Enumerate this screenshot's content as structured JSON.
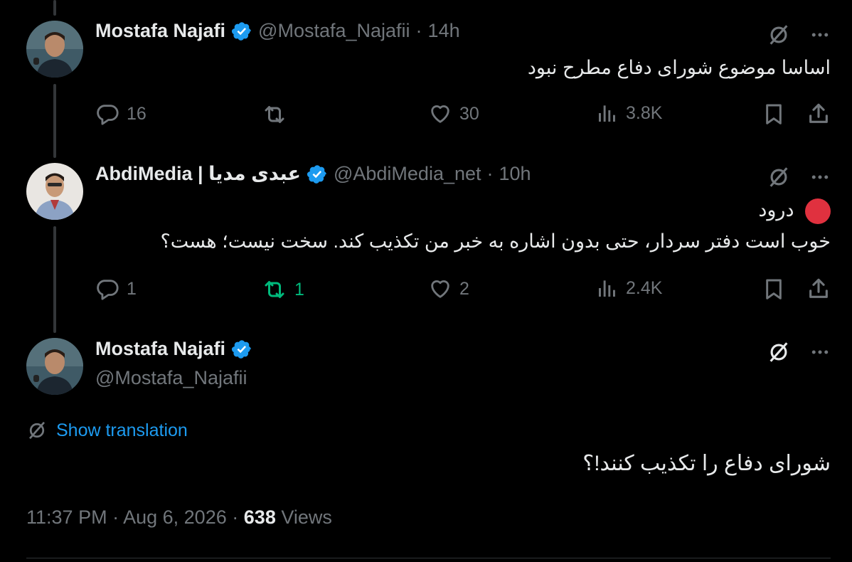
{
  "tweets": [
    {
      "name": "Mostafa Najafi",
      "handle": "@Mostafa_Najafii",
      "time": "14h",
      "text_lines": [
        "اساسا موضوع شورای دفاع مطرح نبود"
      ],
      "replies": "16",
      "reposts": "",
      "likes": "30",
      "views": "3.8K"
    },
    {
      "name": "AbdiMedia | عبدی مدیا",
      "handle": "@AbdiMedia_net",
      "time": "10h",
      "text_lines": [
        "درود",
        "خوب است دفتر سردار، حتی بدون اشاره به خبر من تکذیب کند. سخت نیست؛ هست؟"
      ],
      "replies": "1",
      "reposts": "1",
      "likes": "2",
      "views": "2.4K"
    }
  ],
  "main_tweet": {
    "name": "Mostafa Najafi",
    "handle": "@Mostafa_Najafii",
    "show_translation": "Show translation",
    "text": "شورای دفاع را تکذیب کنند!؟",
    "time": "11:37 PM",
    "date": "Aug 6, 2026",
    "views_count": "638",
    "views_label": "Views"
  },
  "separator": "·",
  "colors": {
    "accent": "#1d9bf0",
    "repost_active": "#00ba7c",
    "muted": "#71767b",
    "red_dot": "#e0313f"
  }
}
